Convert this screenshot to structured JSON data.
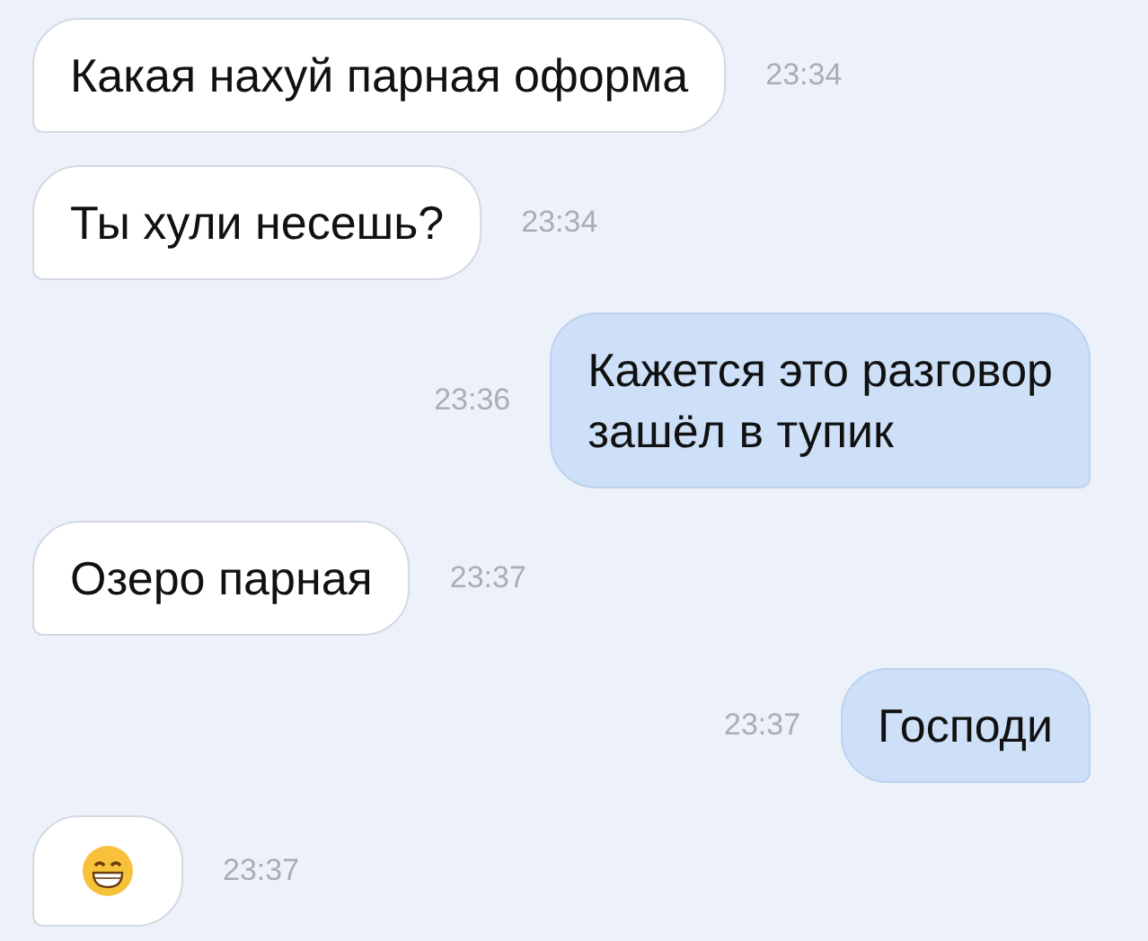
{
  "messages": [
    {
      "outgoing": false,
      "kind": "text",
      "text": "Какая нахуй парная оформа",
      "time": "23:34"
    },
    {
      "outgoing": false,
      "kind": "text",
      "text": "Ты хули несешь?",
      "time": "23:34"
    },
    {
      "outgoing": true,
      "kind": "text",
      "text": "Кажется это разговор\nзашёл в тупик",
      "time": "23:36"
    },
    {
      "outgoing": false,
      "kind": "text",
      "text": "Озеро парная",
      "time": "23:37"
    },
    {
      "outgoing": true,
      "kind": "text",
      "text": "Господи",
      "time": "23:37"
    },
    {
      "outgoing": false,
      "kind": "emoji",
      "time": "23:37"
    }
  ]
}
